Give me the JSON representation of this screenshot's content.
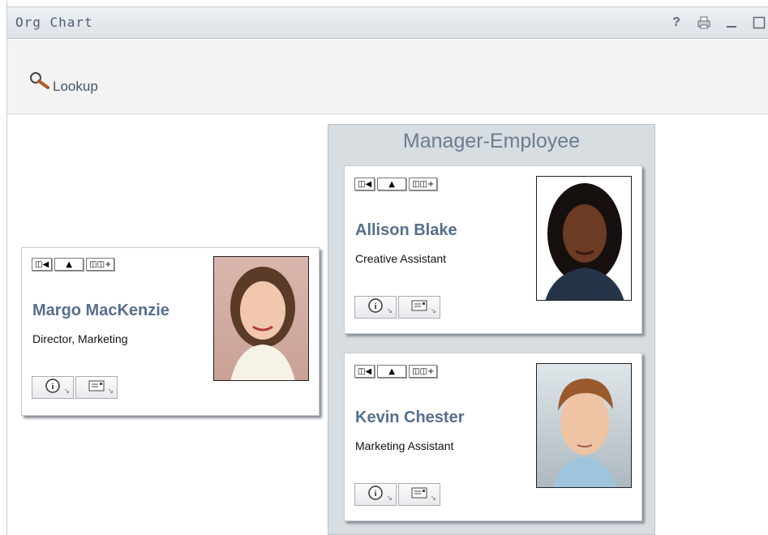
{
  "window": {
    "title": "Org Chart",
    "tools": {
      "help": "?",
      "print": "print-icon",
      "minimize": "minimize-icon",
      "maximize": "maximize-icon"
    }
  },
  "toolbar": {
    "lookup_label": "Lookup"
  },
  "manager_panel": {
    "heading": "Manager-Employee"
  },
  "cards": {
    "margo": {
      "name": "Margo MacKenzie",
      "title": "Director, Marketing"
    },
    "allison": {
      "name": "Allison Blake",
      "title": "Creative Assistant"
    },
    "kevin": {
      "name": "Kevin Chester",
      "title": "Marketing Assistant"
    }
  },
  "card_buttons": {
    "show_manager": "manager-arrow-icon",
    "up_level": "up-arrow-icon",
    "show_reports": "reports-plus-icon",
    "info": "info-icon",
    "email": "email-icon"
  },
  "colors": {
    "name": "#566f8d",
    "heading": "#6c7d90",
    "panel": "#d8dde2"
  }
}
